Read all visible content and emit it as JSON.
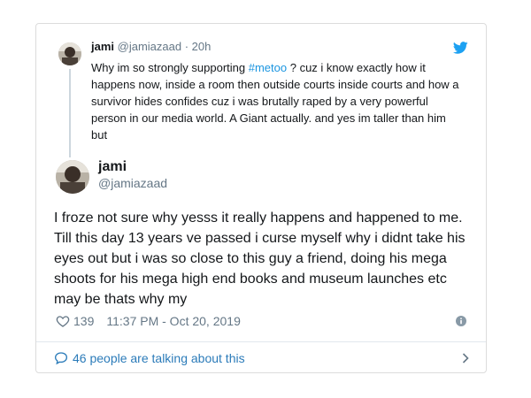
{
  "parent_tweet": {
    "name": "jami",
    "handle": "@jamiazaad",
    "separator": " · ",
    "time": "20h",
    "text_before": "Why im so strongly supporting ",
    "hashtag": "#metoo",
    "text_after": " ? cuz i know exactly how it happens now, inside a room then outside courts inside courts and how a survivor hides confides cuz i was brutally raped by a very powerful person in our media world. A Giant actually. and yes im taller than him but"
  },
  "main_tweet": {
    "name": "jami",
    "handle": "@jamiazaad",
    "text": "I froze not sure why yesss it really happens and happened to me. Till this day 13 years ve passed i curse myself why i didnt take his eyes out but i was so close to this guy a friend, doing his mega shoots for his mega high end books and museum launches etc may be thats why my",
    "likes": "139",
    "timestamp": "11:37 PM - Oct 20, 2019"
  },
  "conversation": {
    "label": "46 people are talking about this"
  },
  "icons": {
    "brand": "twitter-bird-icon",
    "like": "heart-icon",
    "info": "info-icon",
    "talk": "chat-bubble-icon",
    "more": "chevron-right-icon"
  },
  "colors": {
    "twitter_blue": "#1da1f2",
    "link_blue": "#2b7bb9",
    "muted_gray": "#657786",
    "border": "#dcdcdc"
  }
}
